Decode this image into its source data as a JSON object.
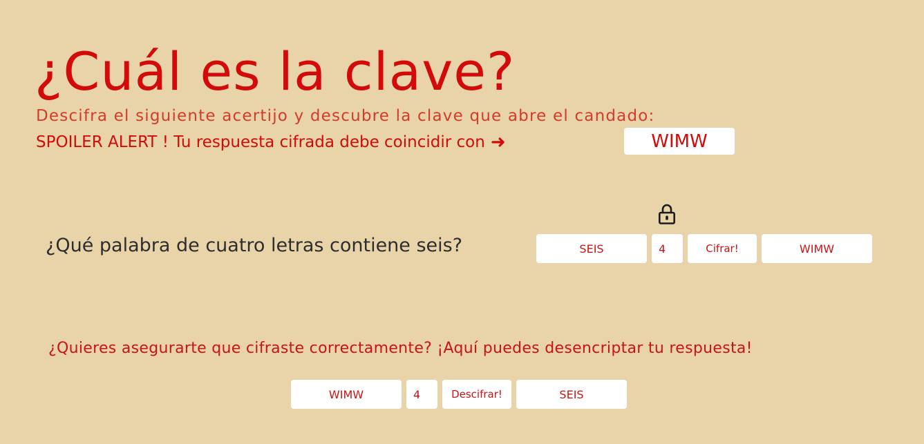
{
  "header": {
    "title": "¿Cuál es la clave?",
    "subtitle": "Descifra el siguiente acertijo y descubre la clave que abre el candado:",
    "spoiler_text": "SPOILER ALERT ! Tu respuesta cifrada debe coincidir con",
    "arrow": "➜",
    "spoiler_value": "WIMW"
  },
  "puzzle": {
    "question": "¿Qué palabra de cuatro letras contiene seis?",
    "lock_icon": "lock-icon",
    "word_input": "SEIS",
    "shift_input": "4",
    "encrypt_label": "Cifrar!",
    "result": "WIMW"
  },
  "decrypt": {
    "prompt": "¿Quieres asegurarte que cifraste correctamente? ¡Aquí puedes desencriptar tu respuesta!",
    "word_input": "WIMW",
    "shift_input": "4",
    "decrypt_label": "Descifrar!",
    "result": "SEIS"
  },
  "colors": {
    "background": "#e8d4a8",
    "accent_red": "#d20a0a",
    "question_text": "#2d2d2d",
    "box_bg": "#ffffff"
  }
}
